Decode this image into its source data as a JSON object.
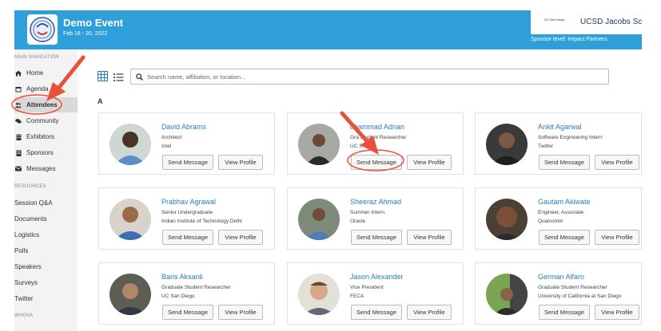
{
  "header": {
    "event_title": "Demo Event",
    "event_dates": "Feb 18 - 20, 2022",
    "sponsor_logo_text": "UC San Diego",
    "sponsor_name": "UCSD Jacobs Scho",
    "sponsor_level": "Sponsor level: Impact Partners",
    "bg_color": "#2f9fd9"
  },
  "sidebar": {
    "main_heading": "MAIN NAVIGATION",
    "nav_items": [
      {
        "label": "Home",
        "icon": "home-icon"
      },
      {
        "label": "Agenda",
        "icon": "calendar-icon"
      },
      {
        "label": "Attendees",
        "icon": "users-icon",
        "active": true
      },
      {
        "label": "Community",
        "icon": "chat-icon"
      },
      {
        "label": "Exhibitors",
        "icon": "building-icon"
      },
      {
        "label": "Sponsors",
        "icon": "sponsor-icon"
      },
      {
        "label": "Messages",
        "icon": "envelope-icon"
      }
    ],
    "resources_heading": "RESOURCES",
    "resource_items": [
      "Session Q&A",
      "Documents",
      "Logistics",
      "Polls",
      "Speakers",
      "Surveys",
      "Twitter"
    ],
    "whova_heading": "WHOVA"
  },
  "toolbar": {
    "search_placeholder": "Search name, affiliation, or location..."
  },
  "section_letter": "A",
  "buttons": {
    "send_message": "Send Message",
    "view_profile": "View Profile"
  },
  "attendees": [
    {
      "name": "David Abrams",
      "title": "Architect",
      "affiliation": "Intel"
    },
    {
      "name": "ohammad Adnan",
      "title": "Gra    Student Researcher",
      "affiliation": "UC S"
    },
    {
      "name": "Ankit Agarwal",
      "title": "Software Engineering Intern",
      "affiliation": "Twitter"
    },
    {
      "name": "Prabhav Agrawal",
      "title": "Senior Undergraduate",
      "affiliation": "Indian Institute of Technology Delhi"
    },
    {
      "name": "Sheeraz Ahmad",
      "title": "Summer Intern",
      "affiliation": "Oracle"
    },
    {
      "name": "Gautam Akiwate",
      "title": "Engineer, Associate",
      "affiliation": "Qualcomm"
    },
    {
      "name": "Baris Aksanli",
      "title": "Graduate Student Researcher",
      "affiliation": "UC San Diego"
    },
    {
      "name": "Jason Alexander",
      "title": "Vice President",
      "affiliation": "FECA"
    },
    {
      "name": "German Alfaro",
      "title": "Graduate Student Researcher",
      "affiliation": "University of California at San Diego"
    }
  ],
  "annotation_color": "#e8513a"
}
